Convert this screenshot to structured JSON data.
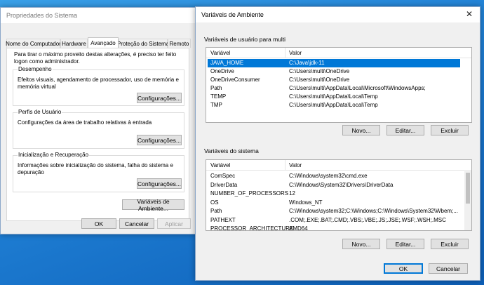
{
  "sysprops": {
    "title": "Propriedades do Sistema",
    "tabs": [
      "Nome do Computador",
      "Hardware",
      "Avançado",
      "Proteção do Sistema",
      "Remoto"
    ],
    "active_tab": "Avançado",
    "admin_note": "Para tirar o máximo proveito destas alterações, é preciso ter feito logon como administrador.",
    "performance": {
      "label": "Desempenho",
      "text": "Efeitos visuais, agendamento de processador, uso de memória e memória virtual",
      "button": "Configurações..."
    },
    "profiles": {
      "label": "Perfis de Usuário",
      "text": "Configurações da área de trabalho relativas à entrada",
      "button": "Configurações..."
    },
    "startup": {
      "label": "Inicialização e Recuperação",
      "text": "Informações sobre inicialização do sistema, falha do sistema e depuração",
      "button": "Configurações..."
    },
    "env_button": "Variáveis de Ambiente...",
    "ok": "OK",
    "cancel": "Cancelar",
    "apply": "Aplicar"
  },
  "envvars": {
    "title": "Variáveis de Ambiente",
    "close_glyph": "✕",
    "user_section": "Variáveis de usuário para multi",
    "col_var": "Variável",
    "col_val": "Valor",
    "user_vars": [
      {
        "name": "JAVA_HOME",
        "value": "C:\\Java\\jdk-11",
        "selected": true
      },
      {
        "name": "OneDrive",
        "value": "C:\\Users\\multi\\OneDrive"
      },
      {
        "name": "OneDriveConsumer",
        "value": "C:\\Users\\multi\\OneDrive"
      },
      {
        "name": "Path",
        "value": "C:\\Users\\multi\\AppData\\Local\\Microsoft\\WindowsApps;"
      },
      {
        "name": "TEMP",
        "value": "C:\\Users\\multi\\AppData\\Local\\Temp"
      },
      {
        "name": "TMP",
        "value": "C:\\Users\\multi\\AppData\\Local\\Temp"
      }
    ],
    "user_buttons": {
      "new": "Novo...",
      "edit": "Editar...",
      "delete": "Excluir"
    },
    "system_section": "Variáveis do sistema",
    "system_vars": [
      {
        "name": "ComSpec",
        "value": "C:\\Windows\\system32\\cmd.exe"
      },
      {
        "name": "DriverData",
        "value": "C:\\Windows\\System32\\Drivers\\DriverData"
      },
      {
        "name": "NUMBER_OF_PROCESSORS",
        "value": "12"
      },
      {
        "name": "OS",
        "value": "Windows_NT"
      },
      {
        "name": "Path",
        "value": "C:\\Windows\\system32;C:\\Windows;C:\\Windows\\System32\\Wbem;..."
      },
      {
        "name": "PATHEXT",
        "value": ".COM;.EXE;.BAT;.CMD;.VBS;.VBE;.JS;.JSE;.WSF;.WSH;.MSC"
      },
      {
        "name": "PROCESSOR_ARCHITECTURE",
        "value": "AMD64"
      }
    ],
    "system_buttons": {
      "new": "Novo...",
      "edit": "Editar...",
      "delete": "Excluir"
    },
    "ok": "OK",
    "cancel": "Cancelar"
  },
  "colors": {
    "selection": "#0078d7",
    "default_button_border": "#0078d7"
  }
}
